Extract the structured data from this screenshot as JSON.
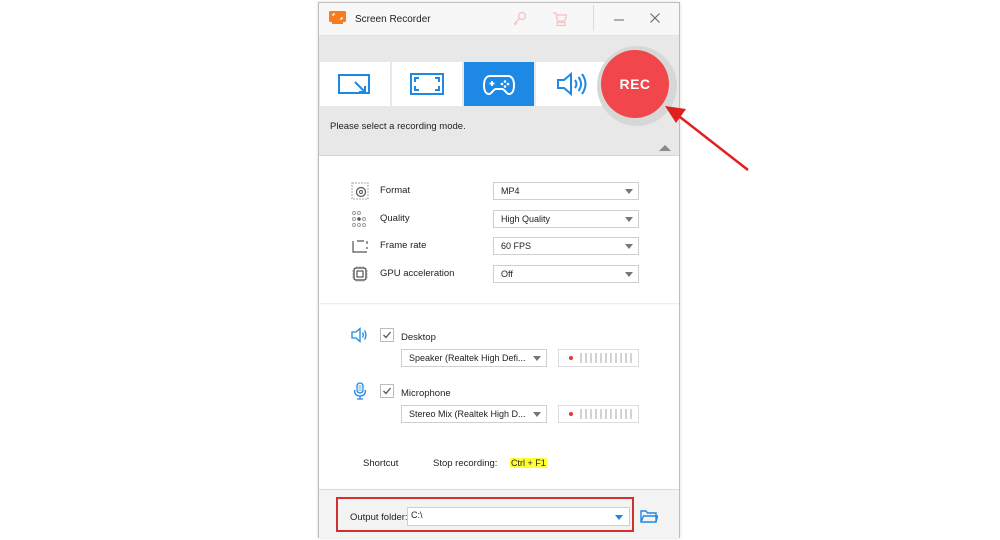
{
  "window": {
    "title": "Screen Recorder",
    "titlebar_icons": [
      "app-logo-icon",
      "key-icon",
      "cart-icon",
      "minimize-icon",
      "close-icon"
    ]
  },
  "modes": {
    "buttons": [
      {
        "name": "region-mode",
        "icon": "region-resize-icon",
        "active": false
      },
      {
        "name": "fullscreen-mode",
        "icon": "fullscreen-icon",
        "active": false
      },
      {
        "name": "game-mode",
        "icon": "gamepad-icon",
        "active": true
      },
      {
        "name": "audio-mode",
        "icon": "speaker-icon",
        "active": false
      }
    ],
    "rec_label": "REC",
    "hint": "Please select a recording mode."
  },
  "settings": {
    "format": {
      "label": "Format",
      "value": "MP4"
    },
    "quality": {
      "label": "Quality",
      "value": "High Quality"
    },
    "frame_rate": {
      "label": "Frame rate",
      "value": "60 FPS"
    },
    "gpu": {
      "label": "GPU acceleration",
      "value": "Off"
    }
  },
  "audio": {
    "desktop": {
      "label": "Desktop",
      "checked": true,
      "device": "Speaker (Realtek High Defi..."
    },
    "microphone": {
      "label": "Microphone",
      "checked": true,
      "device": "Stereo Mix (Realtek High D..."
    }
  },
  "shortcut": {
    "label": "Shortcut",
    "action": "Stop recording:",
    "key": "Ctrl + F1"
  },
  "output": {
    "label": "Output folder:",
    "value": "C:\\"
  },
  "colors": {
    "accent": "#1e88e5",
    "rec": "#f0464c",
    "annotation": "#e02020",
    "shortcut_highlight": "#ffff33"
  }
}
